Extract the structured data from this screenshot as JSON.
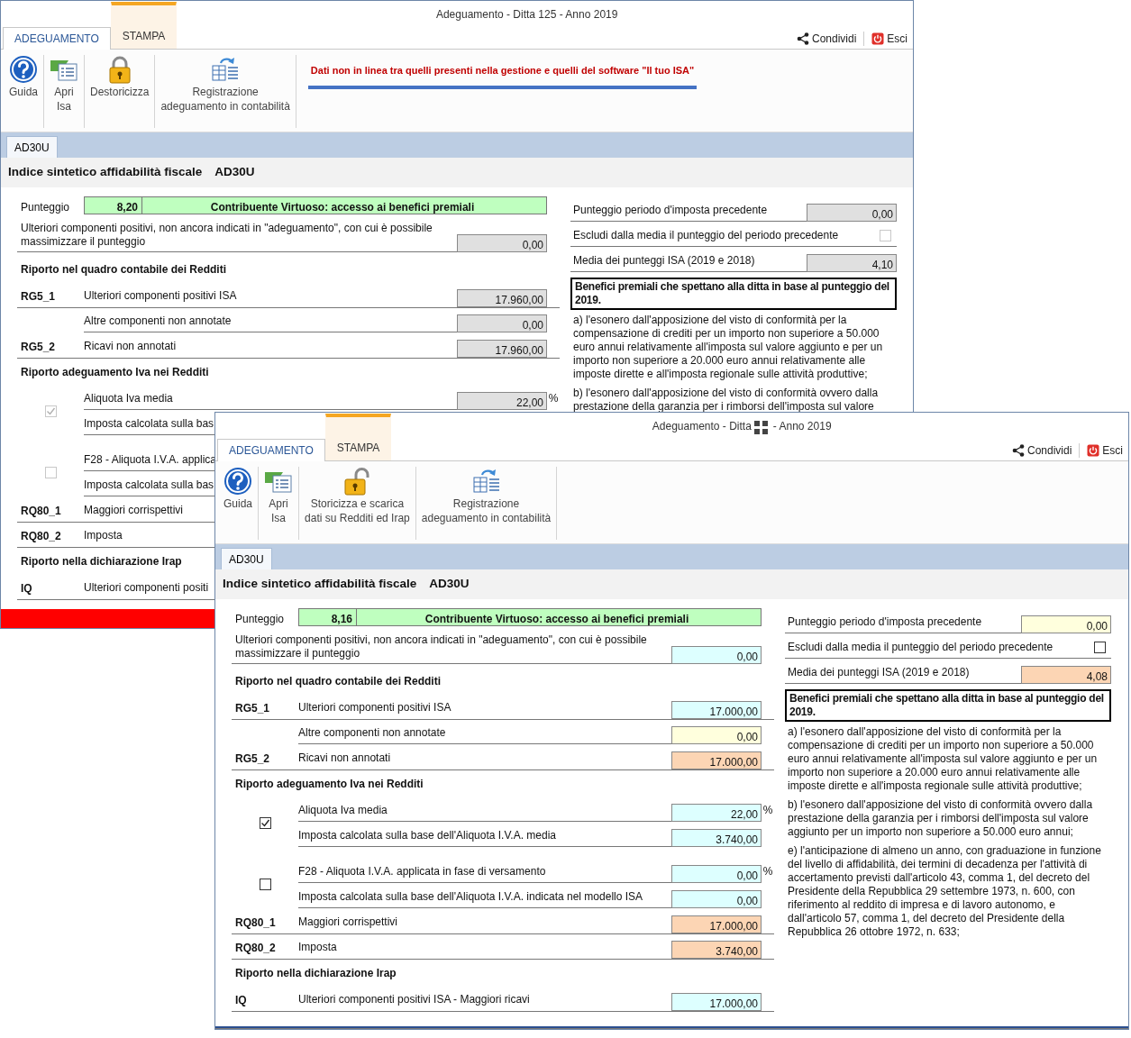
{
  "windows": [
    {
      "title": [
        "Adeguamento - Ditta 125 - Anno 2019"
      ],
      "title_redacted": false,
      "tabs": [
        {
          "label": "ADEGUAMENTO",
          "selected": true
        },
        {
          "label": "STAMPA",
          "selected": false
        }
      ],
      "share": "Condividi",
      "exit": "Esci",
      "ribbon": [
        {
          "kind": "help",
          "label": "Guida"
        },
        {
          "kind": "open",
          "label": "Apri\nIsa"
        },
        {
          "kind": "lock",
          "label": "Destoricizza"
        },
        {
          "kind": "register",
          "label": "Registrazione\nadeguamento in contabilità"
        }
      ],
      "notice": "Dati non in linea tra quelli presenti nella gestione e quelli del software \"Il tuo ISA\"",
      "doc_tabs": [
        "AD30U"
      ],
      "heading": {
        "title": "Indice sintetico affidabilità fiscale",
        "code": "AD30U"
      },
      "score": {
        "label": "Punteggio",
        "value": "8,20",
        "verdict": "Contribuente Virtuoso: accesso ai benefici premiali"
      },
      "left": [
        {
          "kind": "wide",
          "label": "Ulteriori componenti positivi, non ancora indicati in \"adeguamento\", con cui è possibile massimizzare il punteggio",
          "value": "0,00",
          "color": "#e0e0e0"
        },
        {
          "kind": "section",
          "label": "Riporto nel quadro contabile dei Redditi"
        },
        {
          "kind": "field",
          "code": "RG5_1",
          "label": "Ulteriori componenti positivi ISA",
          "value": "17.960,00",
          "color": "#e0e0e0"
        },
        {
          "kind": "field",
          "label": "Altre componenti non annotate",
          "value": "0,00",
          "color": "#e0e0e0"
        },
        {
          "kind": "field",
          "code": "RG5_2",
          "label": "Ricavi non annotati",
          "value": "17.960,00",
          "color": "#e0e0e0"
        },
        {
          "kind": "section",
          "label": "Riporto adeguamento Iva nei Redditi"
        },
        {
          "kind": "check_group",
          "checked": true,
          "disabled": true,
          "rows": [
            {
              "label": "Aliquota Iva media",
              "value": "22,00",
              "color": "#e0e0e0",
              "unit": "%"
            },
            {
              "label": "Imposta calcolata sulla bas"
            }
          ]
        },
        {
          "kind": "check_group",
          "checked": false,
          "disabled": true,
          "rows": [
            {
              "label": "F28 - Aliquota I.V.A. applica"
            },
            {
              "label": "Imposta calcolata sulla bas"
            }
          ]
        },
        {
          "kind": "field",
          "code": "RQ80_1",
          "label": "Maggiori corrispettivi"
        },
        {
          "kind": "field",
          "code": "RQ80_2",
          "label": "Imposta"
        },
        {
          "kind": "section",
          "label": "Riporto nella dichiarazione Irap"
        },
        {
          "kind": "field",
          "code": "IQ",
          "label": "Ulteriori componenti positi"
        }
      ],
      "right": [
        {
          "kind": "field",
          "label": "Punteggio periodo d'imposta precedente",
          "value": "0,00",
          "color": "#e0e0e0"
        },
        {
          "kind": "check",
          "label": "Escludi dalla media il punteggio del periodo precedente",
          "checked": false,
          "disabled": true
        },
        {
          "kind": "field",
          "label": "Media dei punteggi ISA (2019 e 2018)",
          "value": "4,10",
          "color": "#e0e0e0"
        }
      ],
      "benefits": {
        "title": "Benefici premiali che spettano alla ditta in base al punteggio del 2019.",
        "items": [
          "a) l'esonero dall'apposizione del visto di conformità per la compensazione di crediti per un importo non superiore a 50.000 euro annui relativamente all'imposta sul valore aggiunto e per un importo non superiore a 20.000 euro annui relativamente alle imposte dirette e all'imposta regionale sulle attività produttive;",
          "b) l'esonero dall'apposizione del visto di conformità ovvero dalla prestazione della garanzia per i rimborsi dell'imposta sul valore"
        ]
      },
      "footer": {
        "kind": "bar",
        "color": "#ff0000"
      }
    },
    {
      "title": [
        "Adeguamento - Ditta",
        "- Anno 2019"
      ],
      "title_redacted": true,
      "tabs": [
        {
          "label": "ADEGUAMENTO",
          "selected": true
        },
        {
          "label": "STAMPA",
          "selected": false
        }
      ],
      "share": "Condividi",
      "exit": "Esci",
      "ribbon": [
        {
          "kind": "help",
          "label": "Guida"
        },
        {
          "kind": "open",
          "label": "Apri\nIsa"
        },
        {
          "kind": "unlock",
          "label": "Storicizza e scarica\ndati su Redditi ed Irap"
        },
        {
          "kind": "register",
          "label": "Registrazione\nadeguamento in contabilità"
        }
      ],
      "doc_tabs": [
        "AD30U"
      ],
      "heading": {
        "title": "Indice sintetico affidabilità fiscale",
        "code": "AD30U"
      },
      "score": {
        "label": "Punteggio",
        "value": "8,16",
        "verdict": "Contribuente Virtuoso: accesso ai benefici premiali"
      },
      "left": [
        {
          "kind": "wide",
          "label": "Ulteriori componenti positivi, non ancora indicati in \"adeguamento\", con cui è possibile massimizzare il punteggio",
          "value": "0,00",
          "color": "#ddffff"
        },
        {
          "kind": "section",
          "label": "Riporto nel quadro contabile dei Redditi"
        },
        {
          "kind": "field",
          "code": "RG5_1",
          "label": "Ulteriori componenti positivi ISA",
          "value": "17.000,00",
          "color": "#ddffff"
        },
        {
          "kind": "field",
          "label": "Altre componenti non annotate",
          "value": "0,00",
          "color": "#ffffdd"
        },
        {
          "kind": "field",
          "code": "RG5_2",
          "label": "Ricavi non annotati",
          "value": "17.000,00",
          "color": "#fcd5b4"
        },
        {
          "kind": "section",
          "label": "Riporto adeguamento Iva nei Redditi"
        },
        {
          "kind": "check_group",
          "checked": true,
          "disabled": false,
          "rows": [
            {
              "label": "Aliquota Iva media",
              "value": "22,00",
              "color": "#ddffff",
              "unit": "%"
            },
            {
              "label": "Imposta calcolata sulla base dell'Aliquota I.V.A. media",
              "value": "3.740,00",
              "color": "#ddffff"
            }
          ]
        },
        {
          "kind": "check_group",
          "checked": false,
          "disabled": false,
          "rows": [
            {
              "label": "F28 - Aliquota I.V.A. applicata in fase di versamento",
              "value": "0,00",
              "color": "#ddffff",
              "unit": "%"
            },
            {
              "label": "Imposta calcolata sulla base dell'Aliquota I.V.A. indicata nel modello ISA",
              "value": "0,00",
              "color": "#ddffff"
            }
          ]
        },
        {
          "kind": "field",
          "code": "RQ80_1",
          "label": "Maggiori corrispettivi",
          "value": "17.000,00",
          "color": "#fcd5b4"
        },
        {
          "kind": "field",
          "code": "RQ80_2",
          "label": "Imposta",
          "value": "3.740,00",
          "color": "#fcd5b4"
        },
        {
          "kind": "section",
          "label": "Riporto nella dichiarazione Irap"
        },
        {
          "kind": "field",
          "code": "IQ",
          "label": "Ulteriori componenti positivi ISA - Maggiori ricavi",
          "value": "17.000,00",
          "color": "#ddffff"
        }
      ],
      "right": [
        {
          "kind": "field",
          "label": "Punteggio periodo d'imposta precedente",
          "value": "0,00",
          "color": "#ffffdd"
        },
        {
          "kind": "check",
          "label": "Escludi dalla media il punteggio del periodo precedente",
          "checked": false,
          "disabled": false
        },
        {
          "kind": "field",
          "label": "Media dei punteggi ISA (2019 e 2018)",
          "value": "4,08",
          "color": "#fcd5b4"
        }
      ],
      "benefits": {
        "title": "Benefici premiali che spettano alla ditta in base al punteggio del 2019.",
        "items": [
          "a) l'esonero dall'apposizione del visto di conformità per la compensazione di crediti per un importo non superiore a 50.000 euro annui relativamente all'imposta sul valore aggiunto e per un importo non superiore a 20.000 euro annui relativamente alle imposte dirette e all'imposta regionale sulle attività produttive;",
          "b) l'esonero dall'apposizione del visto di conformità ovvero dalla prestazione della garanzia per i rimborsi dell'imposta sul valore aggiunto per un importo non superiore a 50.000 euro annui;",
          "e) l'anticipazione di almeno un anno, con graduazione in funzione del livello di affidabilità, dei termini di decadenza per l'attività di accertamento previsti dall'articolo 43, comma 1, del decreto del Presidente della Repubblica 29 settembre 1973, n. 600, con riferimento al reddito di impresa e di lavoro autonomo, e dall'articolo 57, comma 1, del decreto del Presidente della Repubblica 26 ottobre 1972, n. 633;"
        ]
      },
      "footer": {
        "kind": "line",
        "color": "#2b4f8f"
      }
    }
  ]
}
